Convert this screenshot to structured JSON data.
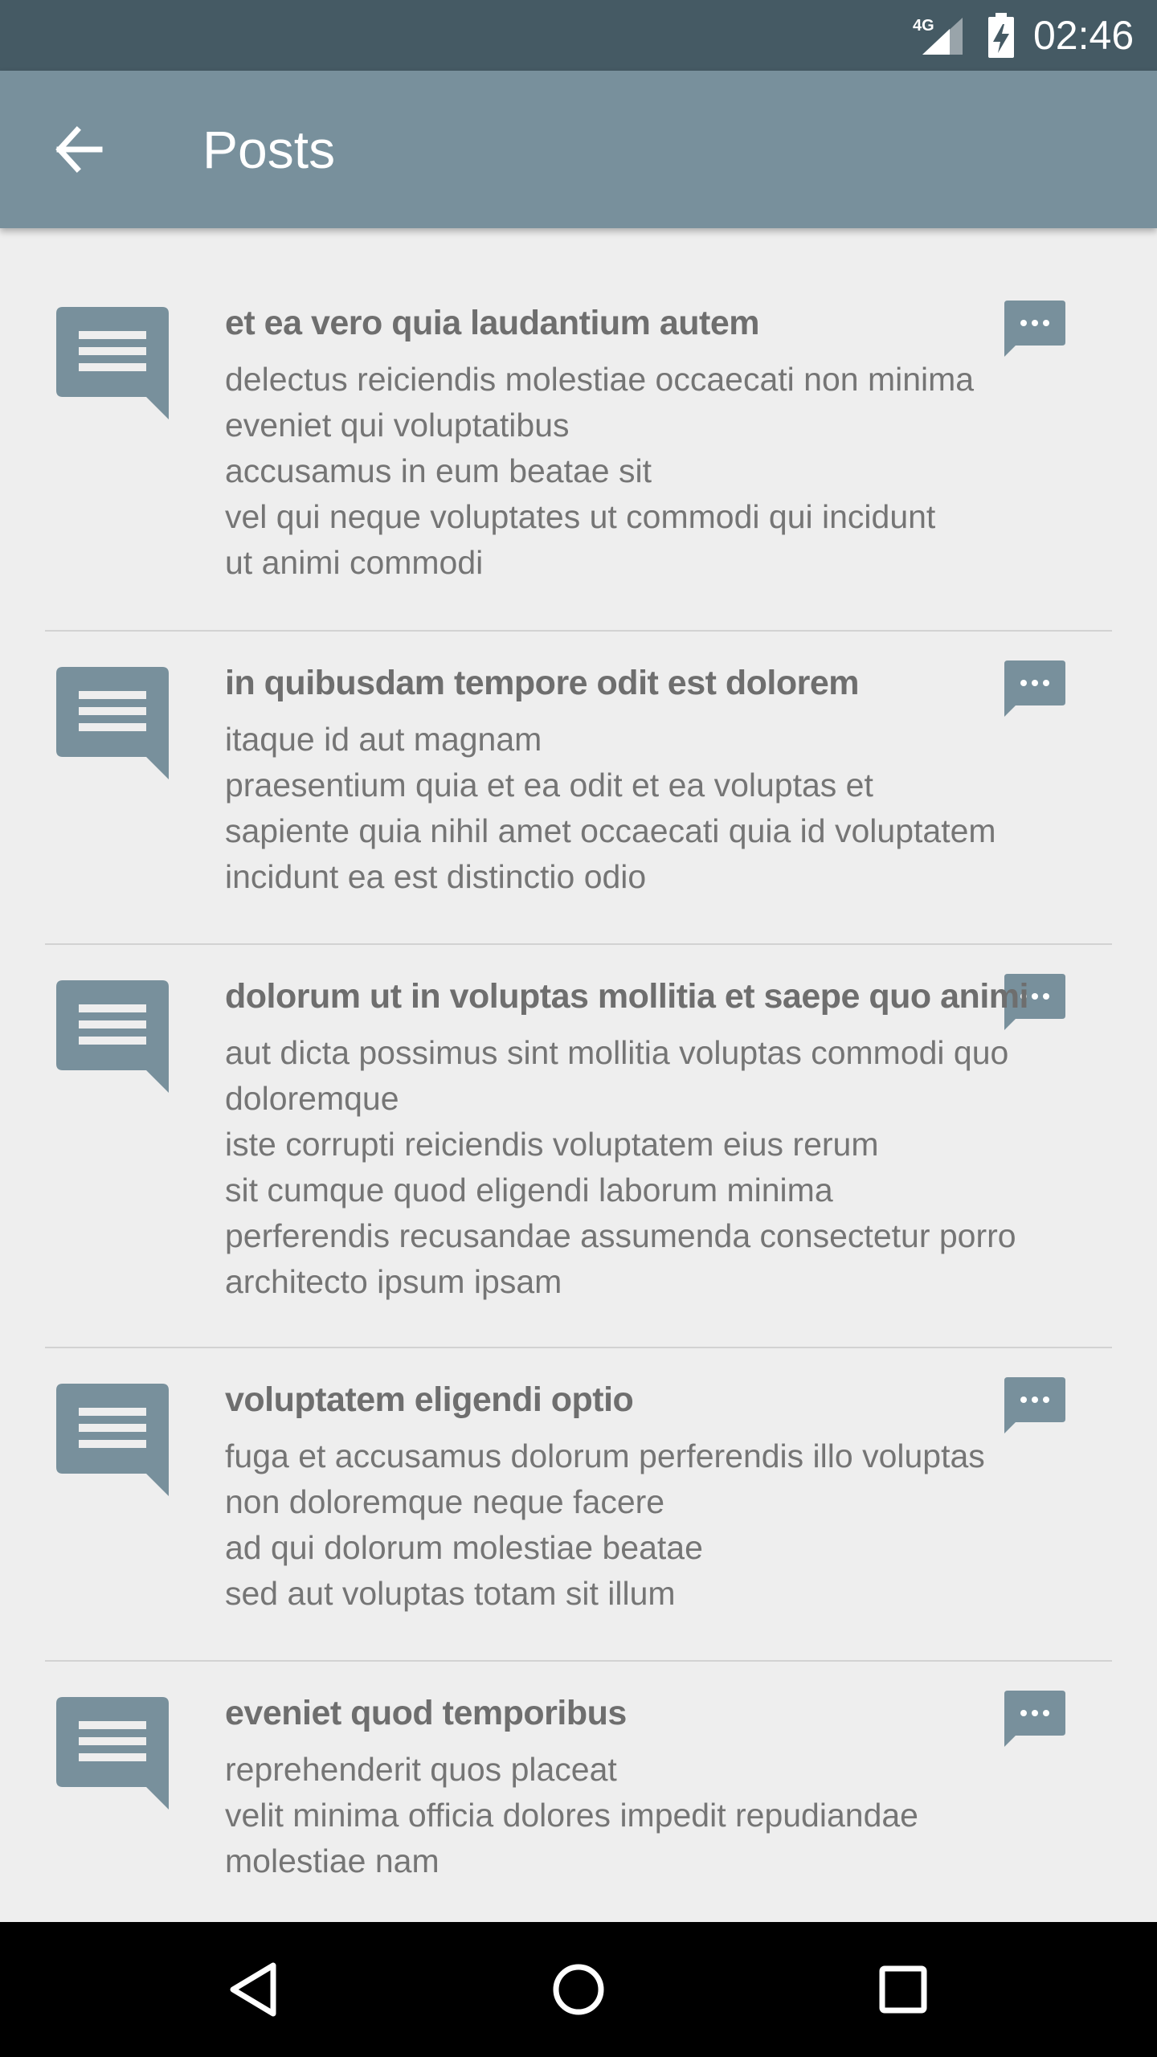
{
  "status_bar": {
    "network": "4G",
    "time": "02:46",
    "icons": [
      "signal-icon",
      "battery-charging-icon"
    ]
  },
  "app_bar": {
    "title": "Posts",
    "back_icon": "arrow-back-icon"
  },
  "colors": {
    "status_bar": "#455a64",
    "app_bar": "#78909c",
    "accent_icon": "#78909c",
    "background": "#eeeeee",
    "title_text": "#6e6e6e",
    "body_text": "#757575",
    "divider": "#d2d2d2",
    "nav_bar": "#000000"
  },
  "posts": [
    {
      "title": "et ea vero quia laudantium autem",
      "body": [
        "delectus reiciendis molestiae occaecati non minima",
        "eveniet qui voluptatibus",
        "accusamus in eum beatae sit",
        "vel qui neque voluptates ut commodi qui incidunt",
        "ut animi commodi"
      ]
    },
    {
      "title": "in quibusdam tempore odit est dolorem",
      "body": [
        "itaque id aut magnam",
        "praesentium quia et ea odit et ea voluptas et",
        "sapiente quia nihil amet occaecati quia id voluptatem",
        "incidunt ea est distinctio odio"
      ]
    },
    {
      "title": "dolorum ut in voluptas mollitia et saepe quo animi",
      "body": [
        "aut dicta possimus sint mollitia voluptas commodi quo",
        "doloremque",
        "iste corrupti reiciendis voluptatem eius rerum",
        "sit cumque quod eligendi laborum minima",
        "perferendis recusandae assumenda consectetur porro",
        "architecto ipsum ipsam"
      ]
    },
    {
      "title": "voluptatem eligendi optio",
      "body": [
        "fuga et accusamus dolorum perferendis illo voluptas",
        "non doloremque neque facere",
        "ad qui dolorum molestiae beatae",
        "sed aut voluptas totam sit illum"
      ]
    },
    {
      "title": "eveniet quod temporibus",
      "body": [
        "reprehenderit quos placeat",
        "velit minima officia dolores impedit repudiandae",
        "molestiae nam"
      ]
    }
  ],
  "nav_bar": {
    "icons": [
      "back-triangle-icon",
      "home-circle-icon",
      "recents-square-icon"
    ]
  }
}
